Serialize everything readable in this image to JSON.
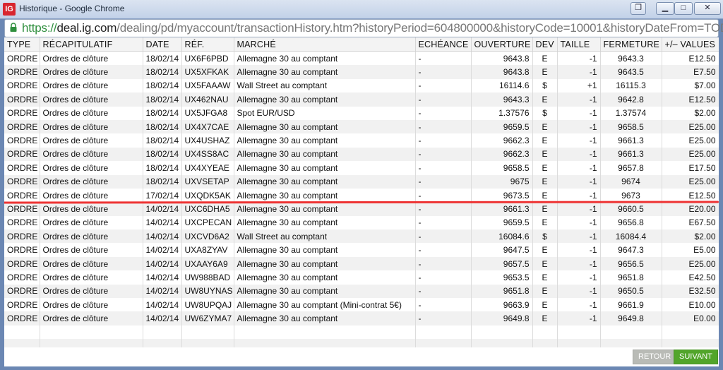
{
  "window": {
    "app_icon_text": "IG",
    "title": "Historique - Google Chrome",
    "controls": {
      "restore": "❐",
      "minimize": "▁",
      "maximize": "□",
      "close": "✕"
    }
  },
  "addressbar": {
    "scheme": "https://",
    "host": "deal.ig.com",
    "path": "/dealing/pd/myaccount/transactionHistory.htm?historyPeriod=604800000&historyCode=10001&historyDateFrom=TODAY&h"
  },
  "table": {
    "headers": [
      "TYPE",
      "RÉCAPITULATIF",
      "DATE",
      "RÉF.",
      "MARCHÉ",
      "ECHÉANCE",
      "OUVERTURE",
      "DEV",
      "TAILLE",
      "FERMETURE",
      "+/– VALUES"
    ],
    "rows": [
      [
        "ORDRE",
        "Ordres de clôture",
        "18/02/14",
        "UX6F6PBD",
        "Allemagne 30 au comptant",
        "-",
        "9643.8",
        "E",
        "-1",
        "9643.3",
        "E12.50"
      ],
      [
        "ORDRE",
        "Ordres de clôture",
        "18/02/14",
        "UX5XFKAK",
        "Allemagne 30 au comptant",
        "-",
        "9643.8",
        "E",
        "-1",
        "9643.5",
        "E7.50"
      ],
      [
        "ORDRE",
        "Ordres de clôture",
        "18/02/14",
        "UX5FAAAW",
        "Wall Street au comptant",
        "-",
        "16114.6",
        "$",
        "+1",
        "16115.3",
        "$7.00"
      ],
      [
        "ORDRE",
        "Ordres de clôture",
        "18/02/14",
        "UX462NAU",
        "Allemagne 30 au comptant",
        "-",
        "9643.3",
        "E",
        "-1",
        "9642.8",
        "E12.50"
      ],
      [
        "ORDRE",
        "Ordres de clôture",
        "18/02/14",
        "UX5JFGA8",
        "Spot EUR/USD",
        "-",
        "1.37576",
        "$",
        "-1",
        "1.37574",
        "$2.00"
      ],
      [
        "ORDRE",
        "Ordres de clôture",
        "18/02/14",
        "UX4X7CAE",
        "Allemagne 30 au comptant",
        "-",
        "9659.5",
        "E",
        "-1",
        "9658.5",
        "E25.00"
      ],
      [
        "ORDRE",
        "Ordres de clôture",
        "18/02/14",
        "UX4USHAZ",
        "Allemagne 30 au comptant",
        "-",
        "9662.3",
        "E",
        "-1",
        "9661.3",
        "E25.00"
      ],
      [
        "ORDRE",
        "Ordres de clôture",
        "18/02/14",
        "UX4SS8AC",
        "Allemagne 30 au comptant",
        "-",
        "9662.3",
        "E",
        "-1",
        "9661.3",
        "E25.00"
      ],
      [
        "ORDRE",
        "Ordres de clôture",
        "18/02/14",
        "UX4XYEAE",
        "Allemagne 30 au comptant",
        "-",
        "9658.5",
        "E",
        "-1",
        "9657.8",
        "E17.50"
      ],
      [
        "ORDRE",
        "Ordres de clôture",
        "18/02/14",
        "UXVSETAP",
        "Allemagne 30 au comptant",
        "-",
        "9675",
        "E",
        "-1",
        "9674",
        "E25.00"
      ],
      [
        "ORDRE",
        "Ordres de clôture",
        "17/02/14",
        "UXQDK5AK",
        "Allemagne 30 au comptant",
        "-",
        "9673.5",
        "E",
        "-1",
        "9673",
        "E12.50"
      ],
      [
        "ORDRE",
        "Ordres de clôture",
        "14/02/14",
        "UXC6DHA5",
        "Allemagne 30 au comptant",
        "-",
        "9661.3",
        "E",
        "-1",
        "9660.5",
        "E20.00"
      ],
      [
        "ORDRE",
        "Ordres de clôture",
        "14/02/14",
        "UXCPECAN",
        "Allemagne 30 au comptant",
        "-",
        "9659.5",
        "E",
        "-1",
        "9656.8",
        "E67.50"
      ],
      [
        "ORDRE",
        "Ordres de clôture",
        "14/02/14",
        "UXCVD6A2",
        "Wall Street au comptant",
        "-",
        "16084.6",
        "$",
        "-1",
        "16084.4",
        "$2.00"
      ],
      [
        "ORDRE",
        "Ordres de clôture",
        "14/02/14",
        "UXA8ZYAV",
        "Allemagne 30 au comptant",
        "-",
        "9647.5",
        "E",
        "-1",
        "9647.3",
        "E5.00"
      ],
      [
        "ORDRE",
        "Ordres de clôture",
        "14/02/14",
        "UXAAY6A9",
        "Allemagne 30 au comptant",
        "-",
        "9657.5",
        "E",
        "-1",
        "9656.5",
        "E25.00"
      ],
      [
        "ORDRE",
        "Ordres de clôture",
        "14/02/14",
        "UW988BAD",
        "Allemagne 30 au comptant",
        "-",
        "9653.5",
        "E",
        "-1",
        "9651.8",
        "E42.50"
      ],
      [
        "ORDRE",
        "Ordres de clôture",
        "14/02/14",
        "UW8UYNAS",
        "Allemagne 30 au comptant",
        "-",
        "9651.8",
        "E",
        "-1",
        "9650.5",
        "E32.50"
      ],
      [
        "ORDRE",
        "Ordres de clôture",
        "14/02/14",
        "UW8UPQAJ",
        "Allemagne 30 au comptant (Mini-contrat 5€)",
        "-",
        "9663.9",
        "E",
        "-1",
        "9661.9",
        "E10.00"
      ],
      [
        "ORDRE",
        "Ordres de clôture",
        "14/02/14",
        "UW6ZYMA7",
        "Allemagne 30 au comptant",
        "-",
        "9649.8",
        "E",
        "-1",
        "9649.8",
        "E0.00"
      ]
    ]
  },
  "footer": {
    "back_label": "RETOUR",
    "next_label": "SUIVANT"
  },
  "colors": {
    "window_frame": "#6b87b3",
    "next_button": "#52a52b",
    "back_button": "#b9bbb6",
    "annotation_line": "#e33333",
    "url_scheme": "#2f8f3e"
  }
}
